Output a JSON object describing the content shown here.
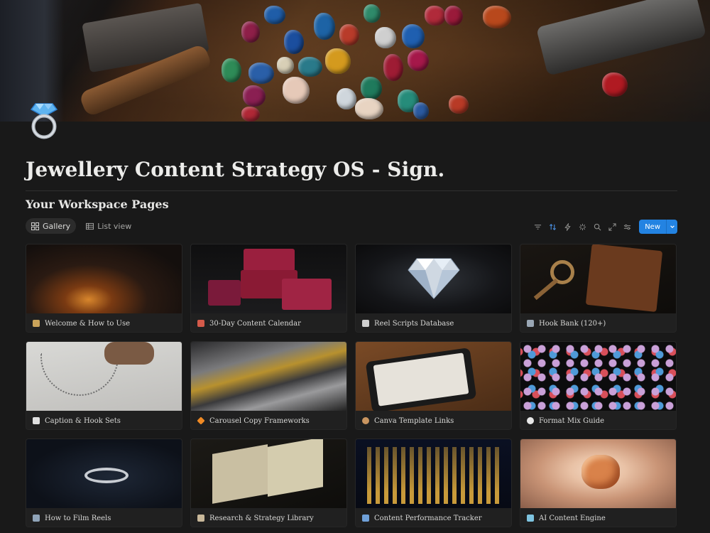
{
  "page": {
    "title": "Jewellery Content Strategy OS - Sign.",
    "icon": "diamond-ring-icon"
  },
  "section": {
    "title": "Your Workspace Pages"
  },
  "views": [
    {
      "label": "Gallery",
      "icon": "gallery-grid-icon",
      "active": true
    },
    {
      "label": "List view",
      "icon": "list-table-icon",
      "active": false
    }
  ],
  "toolbar": {
    "icons": [
      "filter-icon",
      "sort-icon",
      "automation-bolt-icon",
      "ai-sparkle-icon",
      "search-icon",
      "expand-icon",
      "settings-sliders-icon"
    ],
    "new_label": "New"
  },
  "cards": [
    {
      "title": "Welcome & How to Use",
      "icon": "waving-hand-icon",
      "icon_color": "#c9a35a"
    },
    {
      "title": "30-Day Content Calendar",
      "icon": "calendar-icon",
      "icon_color": "#d45a4a"
    },
    {
      "title": "Reel Scripts Database",
      "icon": "page-icon",
      "icon_color": "#cfcfcf"
    },
    {
      "title": "Hook Bank (120+)",
      "icon": "database-icon",
      "icon_color": "#9aa7b5"
    },
    {
      "title": "Caption & Hook Sets",
      "icon": "notepad-icon",
      "icon_color": "#e0e0e0"
    },
    {
      "title": "Carousel Copy Frameworks",
      "icon": "orange-diamond-icon",
      "icon_color": "#f08a24"
    },
    {
      "title": "Canva Template Links",
      "icon": "palette-icon",
      "icon_color": "#c99560"
    },
    {
      "title": "Format Mix Guide",
      "icon": "white-circle-icon",
      "icon_color": "#e8e8e8"
    },
    {
      "title": "How to Film Reels",
      "icon": "film-icon",
      "icon_color": "#8fa3b8"
    },
    {
      "title": "Research & Strategy Library",
      "icon": "books-icon",
      "icon_color": "#c8b89a"
    },
    {
      "title": "Content Performance Tracker",
      "icon": "bar-chart-icon",
      "icon_color": "#6fa0d8"
    },
    {
      "title": "AI Content Engine",
      "icon": "robot-icon",
      "icon_color": "#7ec4e0"
    }
  ]
}
